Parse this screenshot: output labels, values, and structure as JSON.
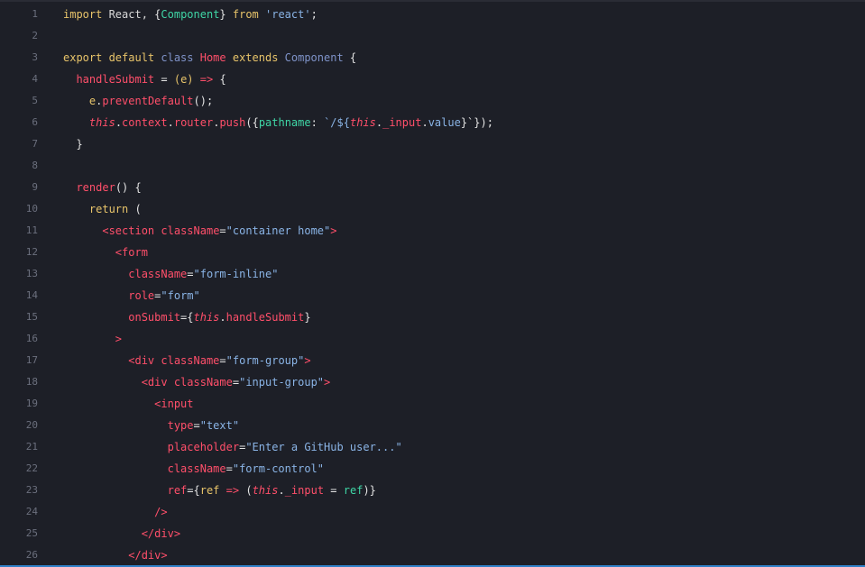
{
  "editor": {
    "accent_color": "#2f80c8",
    "background": "#1d1f27",
    "lines": [
      {
        "num": "1",
        "tokens": [
          [
            "kw",
            "import "
          ],
          [
            "id",
            "React, "
          ],
          [
            "punc",
            "{"
          ],
          [
            "cmp",
            "Component"
          ],
          [
            "punc",
            "} "
          ],
          [
            "kw",
            "from "
          ],
          [
            "str",
            "'react'"
          ],
          [
            "punc",
            ";"
          ]
        ]
      },
      {
        "num": "2",
        "tokens": []
      },
      {
        "num": "3",
        "tokens": [
          [
            "kw",
            "export default "
          ],
          [
            "cls",
            "class "
          ],
          [
            "cname",
            "Home "
          ],
          [
            "ext",
            "extends "
          ],
          [
            "cls",
            "Component "
          ],
          [
            "punc",
            "{"
          ]
        ]
      },
      {
        "num": "4",
        "tokens": [
          [
            "punc",
            "  "
          ],
          [
            "fn",
            "handleSubmit"
          ],
          [
            "punc",
            " = "
          ],
          [
            "var",
            "(e)"
          ],
          [
            "op",
            " => "
          ],
          [
            "punc",
            "{"
          ]
        ]
      },
      {
        "num": "5",
        "tokens": [
          [
            "punc",
            "    "
          ],
          [
            "var",
            "e"
          ],
          [
            "punc",
            "."
          ],
          [
            "fn",
            "preventDefault"
          ],
          [
            "punc",
            "();"
          ]
        ]
      },
      {
        "num": "6",
        "tokens": [
          [
            "punc",
            "    "
          ],
          [
            "this",
            "this"
          ],
          [
            "punc",
            "."
          ],
          [
            "prop",
            "context"
          ],
          [
            "punc",
            "."
          ],
          [
            "prop",
            "router"
          ],
          [
            "punc",
            "."
          ],
          [
            "fn",
            "push"
          ],
          [
            "punc",
            "({"
          ],
          [
            "green",
            "pathname"
          ],
          [
            "punc",
            ": "
          ],
          [
            "str",
            "`/${"
          ],
          [
            "this",
            "this"
          ],
          [
            "punc",
            "."
          ],
          [
            "prop",
            "_input"
          ],
          [
            "punc",
            "."
          ],
          [
            "str",
            "value"
          ],
          [
            "punc",
            "}`"
          ],
          [
            "punc",
            "});"
          ]
        ]
      },
      {
        "num": "7",
        "tokens": [
          [
            "punc",
            "  }"
          ]
        ]
      },
      {
        "num": "8",
        "tokens": []
      },
      {
        "num": "9",
        "tokens": [
          [
            "punc",
            "  "
          ],
          [
            "fn",
            "render"
          ],
          [
            "punc",
            "() {"
          ]
        ]
      },
      {
        "num": "10",
        "tokens": [
          [
            "punc",
            "    "
          ],
          [
            "ret",
            "return "
          ],
          [
            "punc",
            "("
          ]
        ]
      },
      {
        "num": "11",
        "tokens": [
          [
            "punc",
            "      "
          ],
          [
            "tag",
            "<section "
          ],
          [
            "attr",
            "className"
          ],
          [
            "punc",
            "="
          ],
          [
            "str",
            "\"container home\""
          ],
          [
            "tag",
            ">"
          ]
        ]
      },
      {
        "num": "12",
        "tokens": [
          [
            "punc",
            "        "
          ],
          [
            "tag",
            "<form"
          ]
        ]
      },
      {
        "num": "13",
        "tokens": [
          [
            "punc",
            "          "
          ],
          [
            "attr",
            "className"
          ],
          [
            "punc",
            "="
          ],
          [
            "str",
            "\"form-inline\""
          ]
        ]
      },
      {
        "num": "14",
        "tokens": [
          [
            "punc",
            "          "
          ],
          [
            "attr",
            "role"
          ],
          [
            "punc",
            "="
          ],
          [
            "str",
            "\"form\""
          ]
        ]
      },
      {
        "num": "15",
        "tokens": [
          [
            "punc",
            "          "
          ],
          [
            "attr",
            "onSubmit"
          ],
          [
            "punc",
            "={"
          ],
          [
            "this",
            "this"
          ],
          [
            "punc",
            "."
          ],
          [
            "fn",
            "handleSubmit"
          ],
          [
            "punc",
            "}"
          ]
        ]
      },
      {
        "num": "16",
        "tokens": [
          [
            "punc",
            "        "
          ],
          [
            "tag",
            ">"
          ]
        ]
      },
      {
        "num": "17",
        "tokens": [
          [
            "punc",
            "          "
          ],
          [
            "tag",
            "<div "
          ],
          [
            "attr",
            "className"
          ],
          [
            "punc",
            "="
          ],
          [
            "str",
            "\"form-group\""
          ],
          [
            "tag",
            ">"
          ]
        ]
      },
      {
        "num": "18",
        "tokens": [
          [
            "punc",
            "            "
          ],
          [
            "tag",
            "<div "
          ],
          [
            "attr",
            "className"
          ],
          [
            "punc",
            "="
          ],
          [
            "str",
            "\"input-group\""
          ],
          [
            "tag",
            ">"
          ]
        ]
      },
      {
        "num": "19",
        "tokens": [
          [
            "punc",
            "              "
          ],
          [
            "tag",
            "<input"
          ]
        ]
      },
      {
        "num": "20",
        "tokens": [
          [
            "punc",
            "                "
          ],
          [
            "attr",
            "type"
          ],
          [
            "punc",
            "="
          ],
          [
            "str",
            "\"text\""
          ]
        ]
      },
      {
        "num": "21",
        "tokens": [
          [
            "punc",
            "                "
          ],
          [
            "attr",
            "placeholder"
          ],
          [
            "punc",
            "="
          ],
          [
            "str",
            "\"Enter a GitHub user...\""
          ]
        ]
      },
      {
        "num": "22",
        "tokens": [
          [
            "punc",
            "                "
          ],
          [
            "attr",
            "className"
          ],
          [
            "punc",
            "="
          ],
          [
            "str",
            "\"form-control\""
          ]
        ]
      },
      {
        "num": "23",
        "tokens": [
          [
            "punc",
            "                "
          ],
          [
            "attr",
            "ref"
          ],
          [
            "punc",
            "={"
          ],
          [
            "var",
            "ref"
          ],
          [
            "op",
            " => "
          ],
          [
            "punc",
            "("
          ],
          [
            "this",
            "this"
          ],
          [
            "punc",
            "."
          ],
          [
            "prop",
            "_input"
          ],
          [
            "punc",
            " = "
          ],
          [
            "green",
            "ref"
          ],
          [
            "punc",
            ")}"
          ]
        ]
      },
      {
        "num": "24",
        "tokens": [
          [
            "punc",
            "              "
          ],
          [
            "tag",
            "/>"
          ]
        ]
      },
      {
        "num": "25",
        "tokens": [
          [
            "punc",
            "            "
          ],
          [
            "tag",
            "</div>"
          ]
        ]
      },
      {
        "num": "26",
        "tokens": [
          [
            "punc",
            "          "
          ],
          [
            "tag",
            "</div>"
          ]
        ]
      }
    ]
  }
}
